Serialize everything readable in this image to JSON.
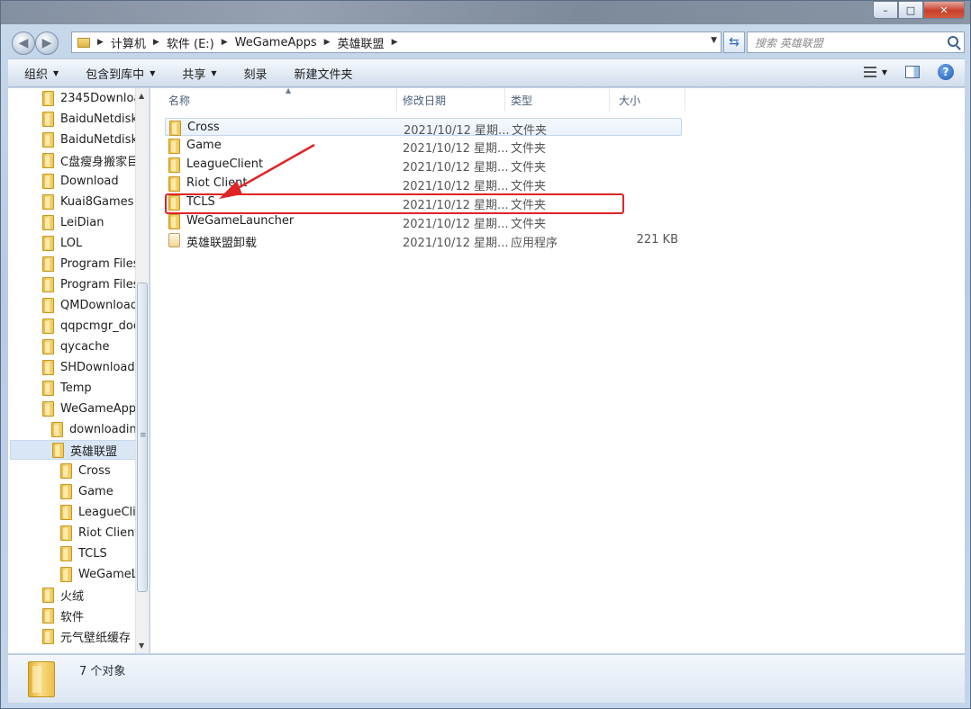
{
  "window": {
    "caption": {
      "minimize": "–",
      "maximize": "□",
      "close": "✕"
    }
  },
  "address_bar": {
    "crumbs": [
      "计算机",
      "软件 (E:)",
      "WeGameApps",
      "英雄联盟"
    ],
    "search_placeholder": "搜索 英雄联盟"
  },
  "toolbar": {
    "organize": "组织",
    "include_in_library": "包含到库中",
    "share": "共享",
    "burn": "刻录",
    "new_folder": "新建文件夹"
  },
  "nav_tree": [
    {
      "label": "2345Downloa",
      "indent": 0
    },
    {
      "label": "BaiduNetdisk",
      "indent": 0
    },
    {
      "label": "BaiduNetdisk",
      "indent": 0
    },
    {
      "label": "C盘瘦身搬家目",
      "indent": 0
    },
    {
      "label": "Download",
      "indent": 0
    },
    {
      "label": "Kuai8Games",
      "indent": 0
    },
    {
      "label": "LeiDian",
      "indent": 0
    },
    {
      "label": "LOL",
      "indent": 0
    },
    {
      "label": "Program Files",
      "indent": 0
    },
    {
      "label": "Program Files",
      "indent": 0
    },
    {
      "label": "QMDownload",
      "indent": 0
    },
    {
      "label": "qqpcmgr_doc",
      "indent": 0
    },
    {
      "label": "qycache",
      "indent": 0
    },
    {
      "label": "SHDownload",
      "indent": 0
    },
    {
      "label": "Temp",
      "indent": 0
    },
    {
      "label": "WeGameApps",
      "indent": 0
    },
    {
      "label": "downloadin",
      "indent": 1
    },
    {
      "label": "英雄联盟",
      "indent": 1,
      "selected": true
    },
    {
      "label": "Cross",
      "indent": 2
    },
    {
      "label": "Game",
      "indent": 2
    },
    {
      "label": "LeagueClie",
      "indent": 2
    },
    {
      "label": "Riot Client",
      "indent": 2
    },
    {
      "label": "TCLS",
      "indent": 2
    },
    {
      "label": "WeGameL",
      "indent": 2
    },
    {
      "label": "火绒",
      "indent": 0
    },
    {
      "label": "软件",
      "indent": 0
    },
    {
      "label": "元气壁纸缓存",
      "indent": 0
    }
  ],
  "file_list": {
    "columns": [
      "名称",
      "修改日期",
      "类型",
      "大小"
    ],
    "rows": [
      {
        "name": "Cross",
        "date": "2021/10/12 星期...",
        "type": "文件夹",
        "size": "",
        "icon": "folder-icon",
        "hovered": true
      },
      {
        "name": "Game",
        "date": "2021/10/12 星期...",
        "type": "文件夹",
        "size": "",
        "icon": "folder-icon"
      },
      {
        "name": "LeagueClient",
        "date": "2021/10/12 星期...",
        "type": "文件夹",
        "size": "",
        "icon": "folder-icon"
      },
      {
        "name": "Riot Client",
        "date": "2021/10/12 星期...",
        "type": "文件夹",
        "size": "",
        "icon": "folder-icon"
      },
      {
        "name": "TCLS",
        "date": "2021/10/12 星期...",
        "type": "文件夹",
        "size": "",
        "icon": "folder-icon",
        "highlighted": true
      },
      {
        "name": "WeGameLauncher",
        "date": "2021/10/12 星期...",
        "type": "文件夹",
        "size": "",
        "icon": "folder-icon"
      },
      {
        "name": "英雄联盟卸载",
        "date": "2021/10/12 星期...",
        "type": "应用程序",
        "size": "221 KB",
        "icon": "app-icon"
      }
    ]
  },
  "annotation": {
    "color": "#e02424"
  },
  "status_bar": {
    "count": "7 个对象"
  }
}
